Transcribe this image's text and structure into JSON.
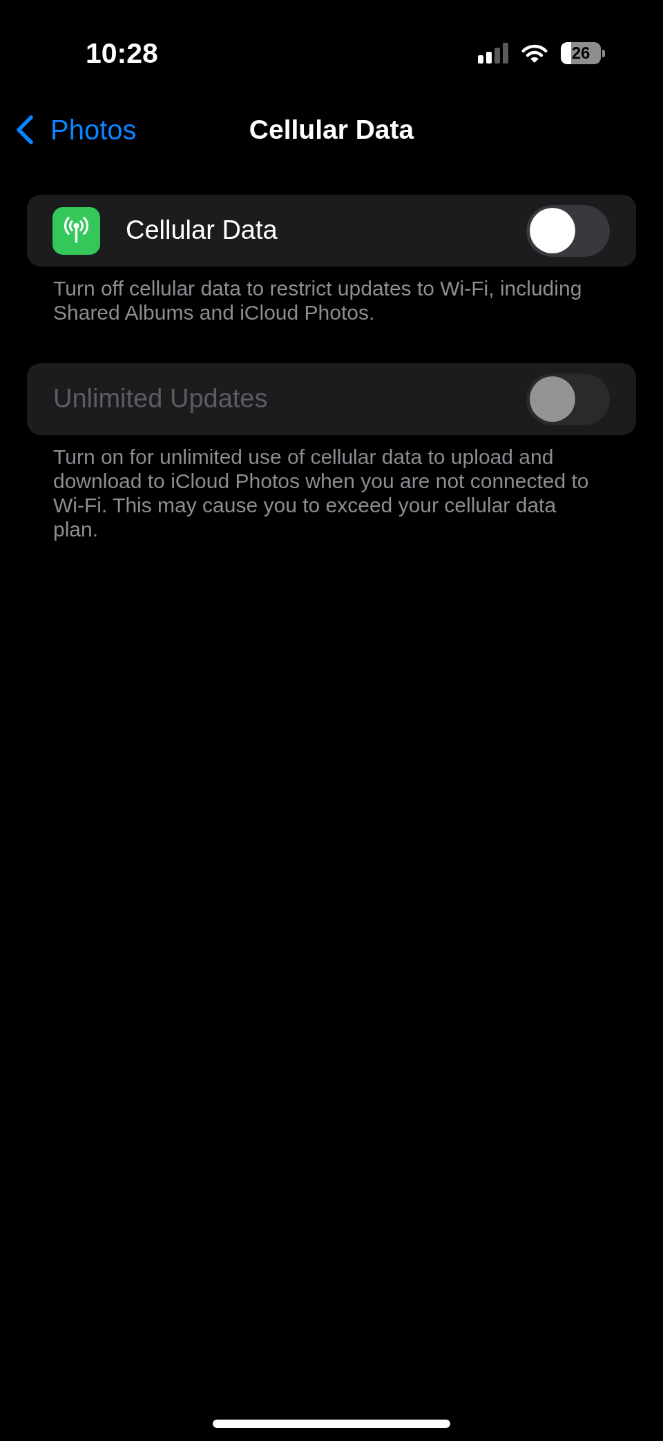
{
  "status_bar": {
    "time": "10:28",
    "battery": "26"
  },
  "nav": {
    "back": "Photos",
    "title": "Cellular Data"
  },
  "sections": [
    {
      "kind": "icon",
      "label": "Cellular Data",
      "on": false,
      "disabled": false,
      "footer": "Turn off cellular data to restrict updates to Wi-Fi, including Shared Albums and iCloud Photos."
    },
    {
      "kind": "plain",
      "label": "Unlimited Updates",
      "on": false,
      "disabled": true,
      "footer": "Turn on for unlimited use of cellular data to upload and download to iCloud Photos when you are not connected to Wi-Fi. This may cause you to exceed your cellular data plan."
    }
  ]
}
